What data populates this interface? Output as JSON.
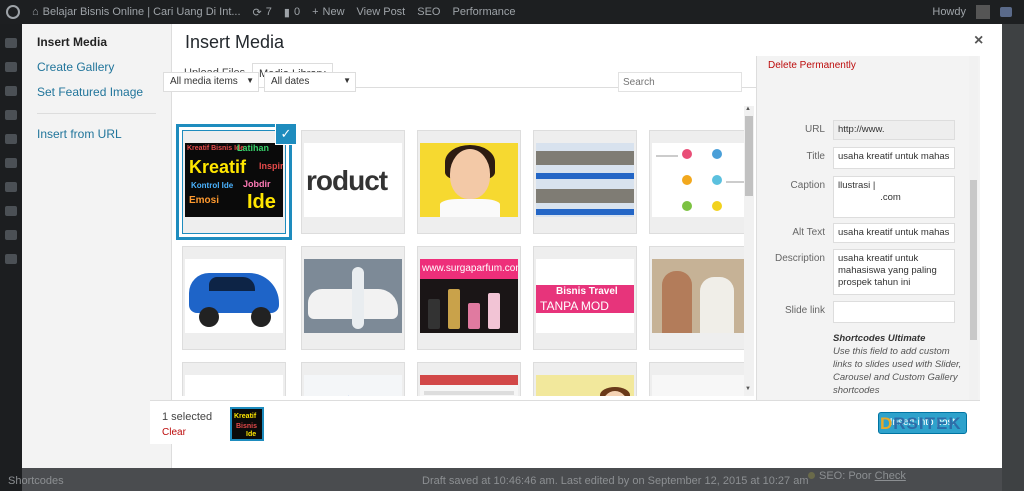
{
  "adminbar": {
    "site_name": "Belajar Bisnis Online | Cari Uang Di Int...",
    "updates_count": "7",
    "comments_count": "0",
    "new_label": "New",
    "view_post_label": "View Post",
    "seo_label": "SEO",
    "performance_label": "Performance",
    "howdy_label": "Howdy"
  },
  "background": {
    "draft_text": "Draft saved at 10:46:46 am. Last edited by",
    "edited_date": "on September 12, 2015 at 10:27 am",
    "sidebar_label": "Shortcodes",
    "seo_status": "SEO: Poor",
    "seo_link": "Check"
  },
  "modal": {
    "menu": {
      "insert_media": "Insert Media",
      "create_gallery": "Create Gallery",
      "set_featured_image": "Set Featured Image",
      "insert_from_url": "Insert from URL"
    },
    "title": "Insert Media",
    "close_glyph": "×",
    "tabs": {
      "upload": "Upload Files",
      "library": "Media Library"
    },
    "filters": {
      "type": "All media items",
      "date": "All dates",
      "search_placeholder": "Search"
    },
    "thumbs": [
      {
        "alt": "kreatif"
      },
      {
        "text": "roduct"
      },
      {
        "alt": "woman"
      },
      {
        "alt": "office"
      },
      {
        "alt": "infographic"
      },
      {
        "alt": "car"
      },
      {
        "alt": "car promo"
      },
      {
        "text": "www.surgaparfum.com"
      },
      {
        "text1": "Bisnis Travel",
        "text2": "TANPA MOD"
      },
      {
        "alt": "couple"
      },
      {
        "alt": "colors"
      },
      {
        "alt": "chart"
      },
      {
        "alt": "web"
      },
      {
        "alt": "cartoon"
      },
      {
        "alt": "blank"
      }
    ],
    "details": {
      "delete_link": "Delete Permanently",
      "url_label": "URL",
      "url_value": "http://www.",
      "title_label": "Title",
      "title_value": "usaha kreatif untuk mahas",
      "caption_label": "Caption",
      "caption_value": "llustrasi |\n                .com",
      "alt_label": "Alt Text",
      "alt_value": "usaha kreatif untuk mahas",
      "description_label": "Description",
      "description_value": "usaha kreatif untuk\nmahasiswa yang paling\nprospek tahun ini",
      "slide_link_label": "Slide link",
      "slide_link_value": "",
      "help_title": "Shortcodes Ultimate",
      "help_text": "Use this field to add custom links to slides used with Slider, Carousel and Custom Gallery shortcodes"
    },
    "toolbar": {
      "selected_count": "1 selected",
      "clear_label": "Clear",
      "insert_button": "Insert into post"
    }
  },
  "watermark": {
    "part1": "D",
    "part2": "RSITEK"
  },
  "colors": {
    "accent": "#1e8cbe",
    "button": "#2ea2cc",
    "danger": "#bc0b0b"
  }
}
